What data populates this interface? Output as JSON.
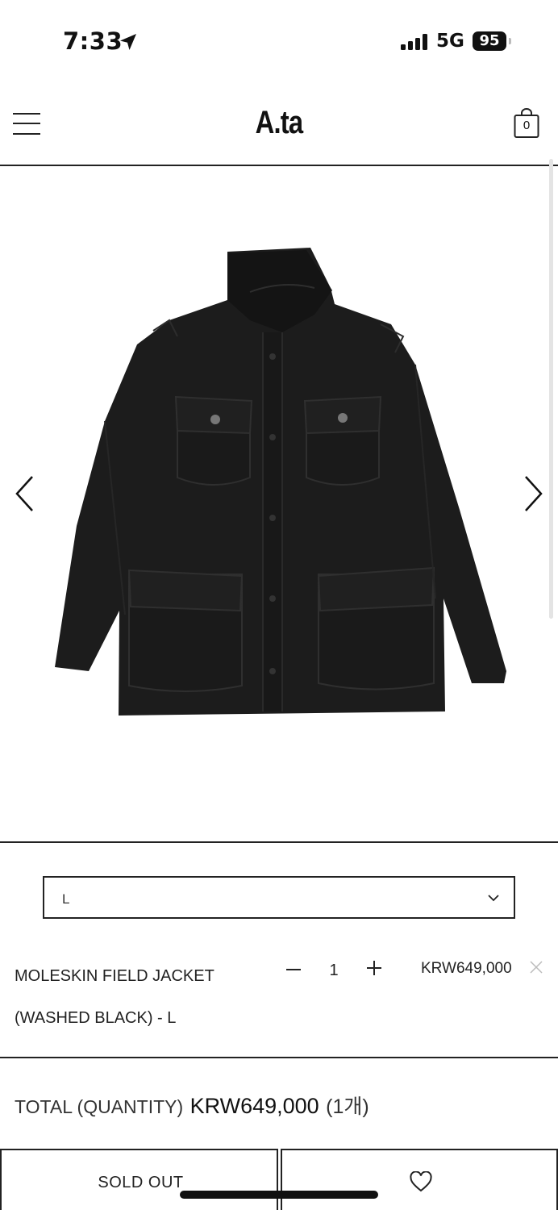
{
  "status_bar": {
    "time": "7:33",
    "network": "5G",
    "battery": "95"
  },
  "header": {
    "logo": "A.ta",
    "cart_count": "0"
  },
  "product": {
    "image_icon": "black-field-jacket-image"
  },
  "size_select": {
    "value": "L"
  },
  "selected_option": {
    "name": "MOLESKIN FIELD JACKET (WASHED BLACK) - L",
    "quantity": "1",
    "price": "KRW649,000"
  },
  "total": {
    "label": "TOTAL (QUANTITY)",
    "price": "KRW649,000",
    "quantity": "(1개)"
  },
  "actions": {
    "sold_out_label": "SOLD OUT"
  }
}
